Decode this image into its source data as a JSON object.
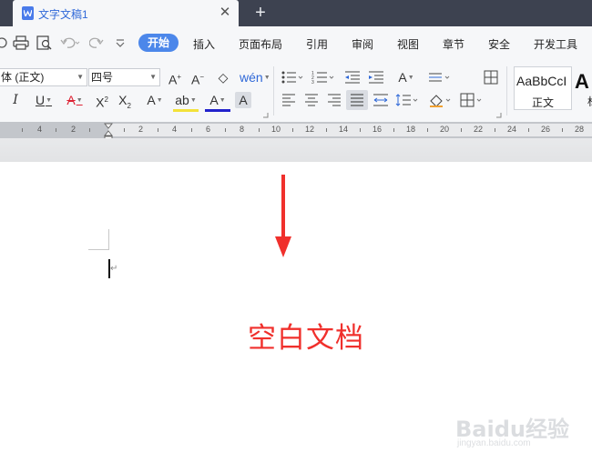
{
  "tabs": [
    {
      "title": "文字文稿1"
    }
  ],
  "tab_close": "✕",
  "new_tab": "+",
  "menu": {
    "active": "开始",
    "items": [
      "插入",
      "页面布局",
      "引用",
      "审阅",
      "视图",
      "章节",
      "安全",
      "开发工具"
    ]
  },
  "ribbon": {
    "font_name": "体 (正文)",
    "font_size": "四号",
    "style_preview": "AaBbCcI",
    "style_name": "正文",
    "next_style_preview": "A",
    "next_style_name": "标"
  },
  "ruler": {
    "left_labels": [
      "4",
      "2"
    ],
    "right_labels": [
      "2",
      "4",
      "6",
      "8",
      "10",
      "12",
      "14",
      "16",
      "18",
      "20",
      "22",
      "24",
      "26",
      "28"
    ]
  },
  "annotation": "空白文档",
  "colors": {
    "accent": "#4c87ea",
    "annotation": "#f0302c",
    "tabbar": "#3d4250"
  },
  "watermark": {
    "text": "Baidu经验",
    "url": "jingyan.baidu.com"
  }
}
